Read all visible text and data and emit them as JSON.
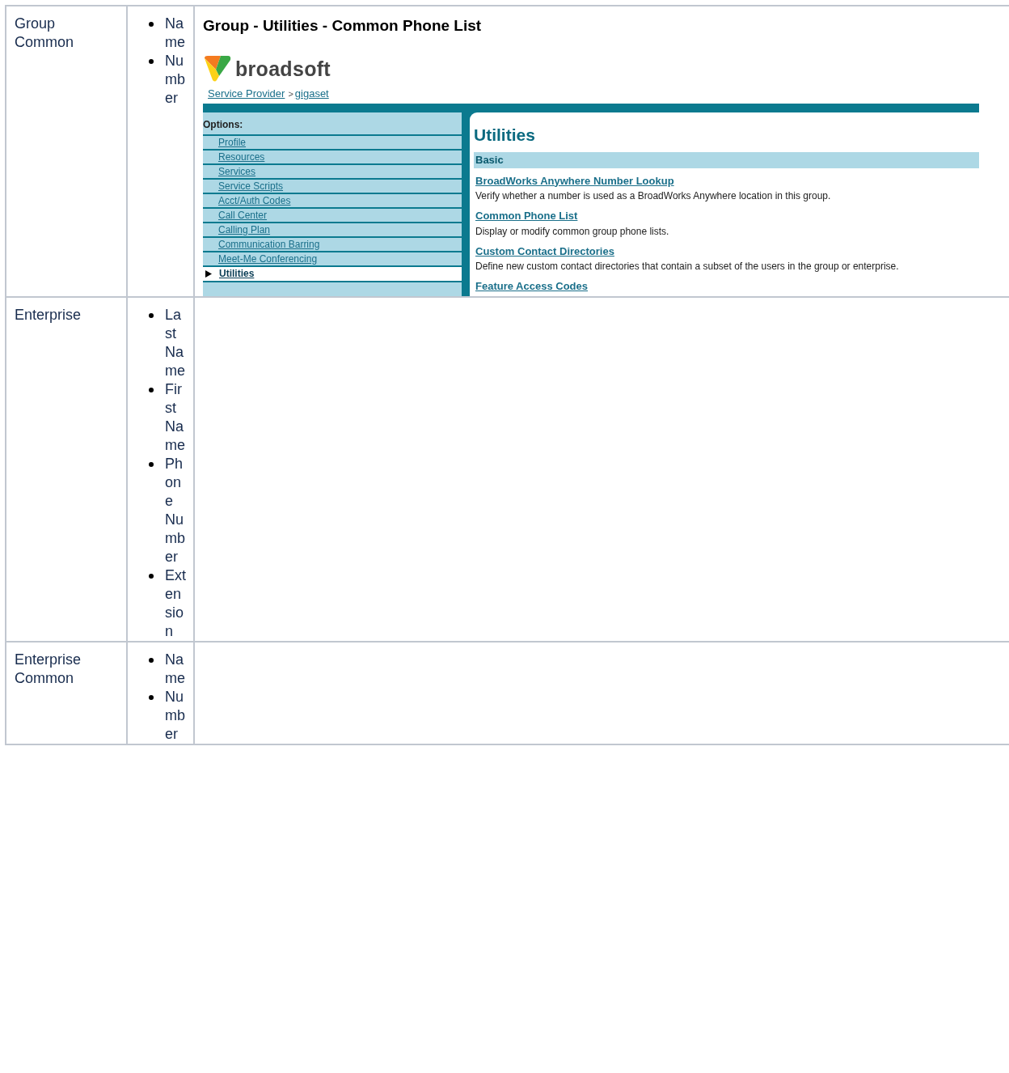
{
  "rows": [
    {
      "label": "Group Common",
      "fields": [
        "Name",
        "Number"
      ],
      "screenshot": {
        "title": "Group - Utilities - Common Phone List",
        "logo_text": "broadsoft",
        "breadcrumb": [
          "Service Provider",
          ">",
          "gigaset"
        ],
        "options_label": "Options:",
        "menu": [
          {
            "label": "Profile",
            "selected": false
          },
          {
            "label": "Resources",
            "selected": false
          },
          {
            "label": "Services",
            "selected": false
          },
          {
            "label": "Service Scripts",
            "selected": false
          },
          {
            "label": "Acct/Auth Codes",
            "selected": false
          },
          {
            "label": "Call Center",
            "selected": false
          },
          {
            "label": "Calling Plan",
            "selected": false
          },
          {
            "label": "Communication Barring",
            "selected": false
          },
          {
            "label": "Meet-Me Conferencing",
            "selected": false
          },
          {
            "label": "Utilities",
            "selected": true
          }
        ],
        "heading": "Utilities",
        "section": "Basic",
        "entries": [
          {
            "link": "BroadWorks Anywhere Number Lookup",
            "description": "Verify whether a number is used as a BroadWorks Anywhere location in this group."
          },
          {
            "link": "Common Phone List",
            "description": "Display or modify common group phone lists."
          },
          {
            "link": "Custom Contact Directories",
            "description": "Define new custom contact directories that contain a subset of the users in the group or enterprise."
          },
          {
            "link": "Feature Access Codes"
          }
        ]
      }
    },
    {
      "label": "Enterprise",
      "fields": [
        "Last Name",
        "First Name",
        "Phone Number",
        "Extension"
      ]
    },
    {
      "label": "Enterprise Common",
      "fields": [
        "Name",
        "Number"
      ]
    }
  ]
}
